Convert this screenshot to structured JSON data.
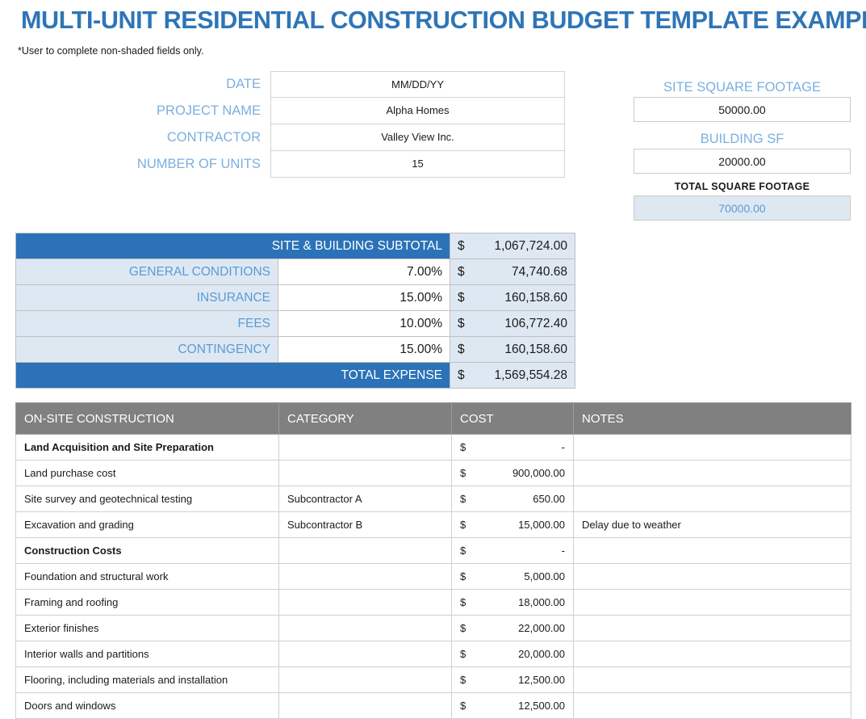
{
  "page_title": "MULTI-UNIT RESIDENTIAL CONSTRUCTION BUDGET TEMPLATE EXAMPLE",
  "note": "*User to complete non-shaded fields only.",
  "colors": {
    "title_blue": "#2E75B6",
    "header_blue": "#2B72B8",
    "shade_blue": "#DEE8F3",
    "label_blue": "#7BAFE0",
    "gray_header": "#808080"
  },
  "info_form": {
    "rows": [
      {
        "label": "DATE",
        "value": "MM/DD/YY"
      },
      {
        "label": "PROJECT NAME",
        "value": "Alpha Homes"
      },
      {
        "label": "CONTRACTOR",
        "value": "Valley View Inc."
      },
      {
        "label": "NUMBER OF UNITS",
        "value": "15"
      }
    ]
  },
  "square_footage": {
    "site_label": "SITE SQUARE FOOTAGE",
    "site_value": "50000.00",
    "building_label": "BUILDING SF",
    "building_value": "20000.00",
    "total_label": "TOTAL SQUARE FOOTAGE",
    "total_value": "70000.00"
  },
  "subtotal_table": {
    "header": {
      "label": "SITE & BUILDING SUBTOTAL",
      "currency": "$",
      "amount": "1,067,724.00"
    },
    "rows": [
      {
        "label": "GENERAL CONDITIONS",
        "percent": "7.00%",
        "currency": "$",
        "amount": "74,740.68"
      },
      {
        "label": "INSURANCE",
        "percent": "15.00%",
        "currency": "$",
        "amount": "160,158.60"
      },
      {
        "label": "FEES",
        "percent": "10.00%",
        "currency": "$",
        "amount": "106,772.40"
      },
      {
        "label": "CONTINGENCY",
        "percent": "15.00%",
        "currency": "$",
        "amount": "160,158.60"
      }
    ],
    "total": {
      "label": "TOTAL EXPENSE",
      "currency": "$",
      "amount": "1,569,554.28"
    }
  },
  "main_table": {
    "columns": [
      "ON-SITE CONSTRUCTION",
      "CATEGORY",
      "COST",
      "NOTES"
    ],
    "rows": [
      {
        "type": "section",
        "item": "Land Acquisition and Site Preparation",
        "category": "",
        "currency": "$",
        "cost": "-",
        "notes": ""
      },
      {
        "type": "item",
        "item": "Land purchase cost",
        "category": "",
        "currency": "$",
        "cost": "900,000.00",
        "notes": ""
      },
      {
        "type": "item",
        "item": "Site survey and geotechnical testing",
        "category": "Subcontractor A",
        "currency": "$",
        "cost": "650.00",
        "notes": ""
      },
      {
        "type": "item",
        "item": "Excavation and grading",
        "category": "Subcontractor B",
        "currency": "$",
        "cost": "15,000.00",
        "notes": "Delay due to weather"
      },
      {
        "type": "section",
        "item": "Construction Costs",
        "category": "",
        "currency": "$",
        "cost": "-",
        "notes": ""
      },
      {
        "type": "item",
        "item": "Foundation and structural work",
        "category": "",
        "currency": "$",
        "cost": "5,000.00",
        "notes": ""
      },
      {
        "type": "item",
        "item": "Framing and roofing",
        "category": "",
        "currency": "$",
        "cost": "18,000.00",
        "notes": ""
      },
      {
        "type": "item",
        "item": "Exterior finishes",
        "category": "",
        "currency": "$",
        "cost": "22,000.00",
        "notes": ""
      },
      {
        "type": "item",
        "item": "Interior walls and partitions",
        "category": "",
        "currency": "$",
        "cost": "20,000.00",
        "notes": ""
      },
      {
        "type": "item",
        "item": "Flooring, including materials and installation",
        "category": "",
        "currency": "$",
        "cost": "12,500.00",
        "notes": ""
      },
      {
        "type": "item",
        "item": "Doors and windows",
        "category": "",
        "currency": "$",
        "cost": "12,500.00",
        "notes": ""
      }
    ]
  }
}
